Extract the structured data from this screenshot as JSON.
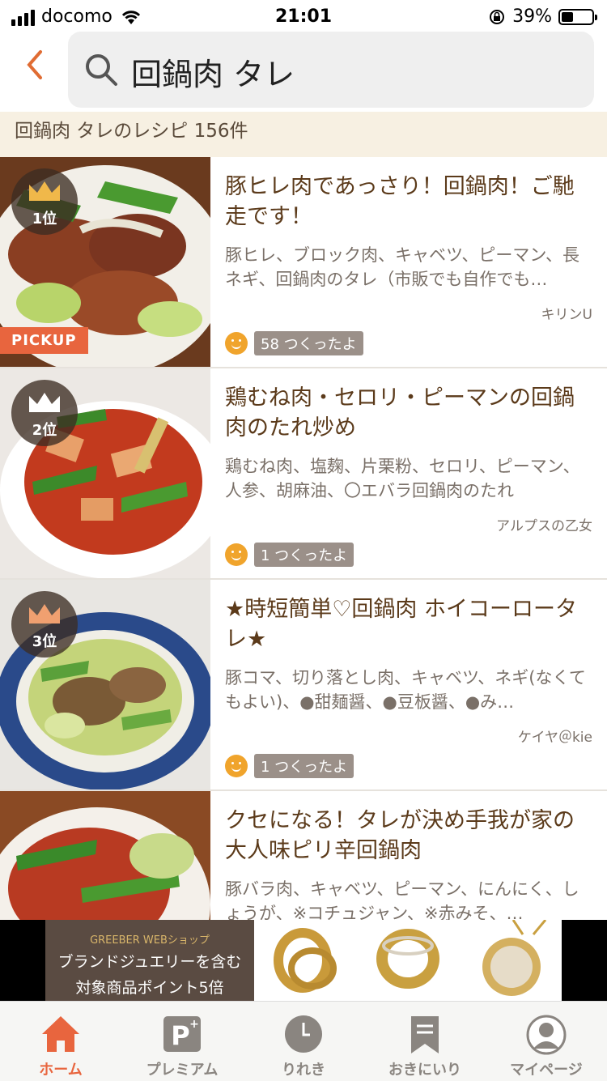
{
  "status_bar": {
    "carrier": "docomo",
    "time": "21:01",
    "battery": "39%"
  },
  "search": {
    "query": "回鍋肉 タレ"
  },
  "results_count_text": "回鍋肉 タレのレシピ 156件",
  "recipes": [
    {
      "rank": "1位",
      "pickup": "PICKUP",
      "title": "豚ヒレ肉であっさり！回鍋肉！ご馳走です！",
      "ingredients": "豚ヒレ、ブロック肉、キャベツ、ピーマン、長ネギ、回鍋肉のタレ（市販でも自作でも…",
      "author": "キリンU",
      "tsukutta": "58 つくったよ"
    },
    {
      "rank": "2位",
      "title": "鶏むね肉・セロリ・ピーマンの回鍋肉のたれ炒め",
      "ingredients": "鶏むね肉、塩麹、片栗粉、セロリ、ピーマン、人参、胡麻油、〇エバラ回鍋肉のたれ",
      "author": "アルプスの乙女",
      "tsukutta": "1 つくったよ"
    },
    {
      "rank": "3位",
      "title": "★時短簡単♡回鍋肉 ホイコーロータレ★",
      "ingredients": "豚コマ、切り落とし肉、キャベツ、ネギ(なくてもよい)、●甜麺醤、●豆板醤、●み…",
      "author": "ケイヤ＠kie",
      "tsukutta": "1 つくったよ"
    },
    {
      "title": "クセになる！タレが決め手我が家の大人味ピリ辛回鍋肉",
      "ingredients": "豚バラ肉、キャベツ、ピーマン、にんにく、しょうが、※コチュジャン、※赤みそ、…"
    }
  ],
  "ad": {
    "shop": "GREEBER WEBショップ",
    "line1": "ブランドジュエリーを含む",
    "line2": "対象商品ポイント5倍"
  },
  "tabs": [
    {
      "label": "ホーム",
      "icon": "home-icon"
    },
    {
      "label": "プレミアム",
      "icon": "premium-icon"
    },
    {
      "label": "りれき",
      "icon": "history-icon"
    },
    {
      "label": "おきにいり",
      "icon": "bookmark-icon"
    },
    {
      "label": "マイページ",
      "icon": "user-icon"
    }
  ],
  "colors": {
    "accent": "#e8653e",
    "title": "#5b3a1a",
    "gold": "#f0b84a",
    "silver": "#ffffff",
    "bronze": "#f0a070"
  }
}
